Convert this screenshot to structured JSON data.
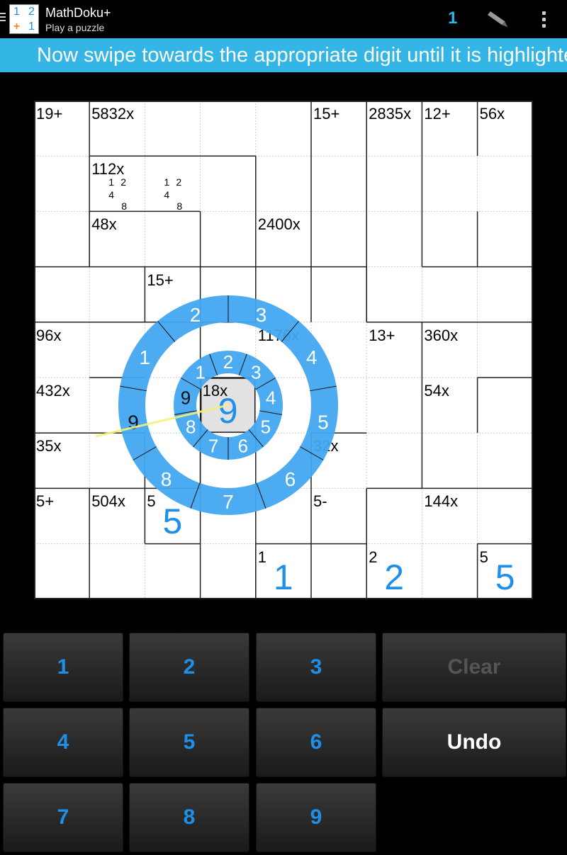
{
  "app": {
    "title": "MathDoku+",
    "subtitle": "Play a puzzle",
    "counter": "1",
    "logo": {
      "tl": "1",
      "tr": "2",
      "bl": "+",
      "br": "1"
    }
  },
  "banner": {
    "text": "Now swipe towards the appropriate digit until it is highlighted"
  },
  "grid": {
    "size": 9,
    "cages": [
      {
        "label": "19+",
        "row": 0,
        "col": 0
      },
      {
        "label": "5832x",
        "row": 0,
        "col": 1
      },
      {
        "label": "15+",
        "row": 0,
        "col": 5
      },
      {
        "label": "2835x",
        "row": 0,
        "col": 6
      },
      {
        "label": "12+",
        "row": 0,
        "col": 7
      },
      {
        "label": "56x",
        "row": 0,
        "col": 8
      },
      {
        "label": "112x",
        "row": 1,
        "col": 1
      },
      {
        "label": "48x",
        "row": 2,
        "col": 1
      },
      {
        "label": "2400x",
        "row": 2,
        "col": 4
      },
      {
        "label": "15+",
        "row": 3,
        "col": 2
      },
      {
        "label": "96x",
        "row": 4,
        "col": 0
      },
      {
        "label": "1176x",
        "row": 4,
        "col": 4
      },
      {
        "label": "13+",
        "row": 4,
        "col": 6
      },
      {
        "label": "360x",
        "row": 4,
        "col": 7
      },
      {
        "label": "432x",
        "row": 5,
        "col": 0
      },
      {
        "label": "18x",
        "row": 5,
        "col": 3
      },
      {
        "label": "54x",
        "row": 5,
        "col": 7
      },
      {
        "label": "35x",
        "row": 6,
        "col": 0
      },
      {
        "label": "32x",
        "row": 6,
        "col": 5
      },
      {
        "label": "5+",
        "row": 7,
        "col": 0
      },
      {
        "label": "504x",
        "row": 7,
        "col": 1
      },
      {
        "label": "5",
        "row": 7,
        "col": 2
      },
      {
        "label": "5-",
        "row": 7,
        "col": 5
      },
      {
        "label": "144x",
        "row": 7,
        "col": 7
      },
      {
        "label": "1",
        "row": 8,
        "col": 4
      },
      {
        "label": "2",
        "row": 8,
        "col": 6
      },
      {
        "label": "5",
        "row": 8,
        "col": 8
      }
    ],
    "values": [
      {
        "row": 7,
        "col": 2,
        "value": "5"
      },
      {
        "row": 8,
        "col": 4,
        "value": "1"
      },
      {
        "row": 8,
        "col": 6,
        "value": "2"
      },
      {
        "row": 8,
        "col": 8,
        "value": "5"
      },
      {
        "row": 5,
        "col": 3,
        "value": "9"
      }
    ],
    "maybes": [
      {
        "row": 1,
        "col": 1,
        "digits": [
          "1",
          "2",
          "4",
          "8"
        ]
      },
      {
        "row": 1,
        "col": 2,
        "digits": [
          "1",
          "2",
          "4",
          "8"
        ]
      }
    ],
    "selected": {
      "row": 5,
      "col": 3
    }
  },
  "swipe_wheel": {
    "inner_digits": [
      "2",
      "3",
      "4",
      "5",
      "6",
      "7",
      "8",
      "9",
      "1"
    ],
    "outer_digits": [
      "3",
      "4",
      "5",
      "6",
      "7",
      "8",
      "9",
      "1",
      "2"
    ],
    "highlighted": "9",
    "color": "#42a7f0"
  },
  "keypad": {
    "keys": [
      "1",
      "2",
      "3",
      "4",
      "5",
      "6",
      "7",
      "8",
      "9"
    ],
    "clear_label": "Clear",
    "undo_label": "Undo"
  }
}
